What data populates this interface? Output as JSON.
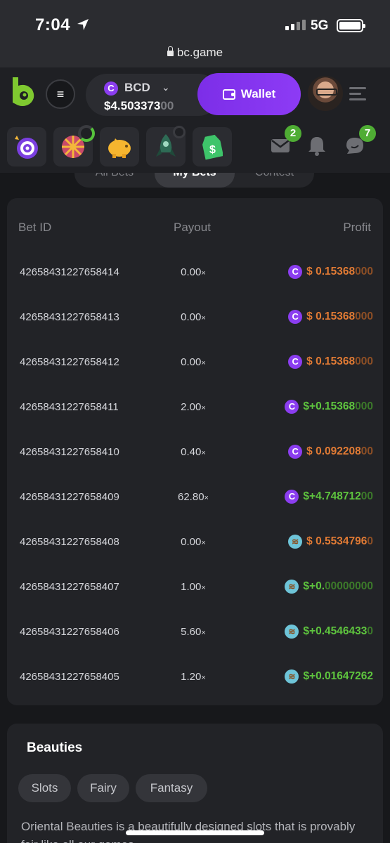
{
  "status": {
    "time": "7:04",
    "network": "5G"
  },
  "browser": {
    "url": "bc.game"
  },
  "header": {
    "currency": "BCD",
    "balance_main": "$4.503373",
    "balance_dim": "00",
    "wallet_label": "Wallet"
  },
  "promo": {
    "mail_badge": "2",
    "chat_badge": "7"
  },
  "tabs": [
    {
      "label": "All Bets"
    },
    {
      "label": "My Bets"
    },
    {
      "label": "Contest"
    }
  ],
  "table": {
    "headers": {
      "bet_id": "Bet ID",
      "payout": "Payout",
      "profit": "Profit"
    },
    "rows": [
      {
        "id": "42658431227658414",
        "payout": "0.00",
        "coin": "bcd",
        "sign": "neg",
        "profit": "$ 0.15368",
        "fade": "000"
      },
      {
        "id": "42658431227658413",
        "payout": "0.00",
        "coin": "bcd",
        "sign": "neg",
        "profit": "$ 0.15368",
        "fade": "000"
      },
      {
        "id": "42658431227658412",
        "payout": "0.00",
        "coin": "bcd",
        "sign": "neg",
        "profit": "$ 0.15368",
        "fade": "000"
      },
      {
        "id": "42658431227658411",
        "payout": "2.00",
        "coin": "bcd",
        "sign": "pos",
        "profit": "$+0.15368",
        "fade": "000"
      },
      {
        "id": "42658431227658410",
        "payout": "0.40",
        "coin": "bcd",
        "sign": "neg",
        "profit": "$ 0.092208",
        "fade": "00"
      },
      {
        "id": "42658431227658409",
        "payout": "62.80",
        "coin": "bcd",
        "sign": "pos",
        "profit": "$+4.748712",
        "fade": "00"
      },
      {
        "id": "42658431227658408",
        "payout": "0.00",
        "coin": "pan",
        "sign": "neg",
        "profit": "$ 0.5534796",
        "fade": "0"
      },
      {
        "id": "42658431227658407",
        "payout": "1.00",
        "coin": "pan",
        "sign": "pos",
        "profit": "$+0.",
        "fade": "00000000"
      },
      {
        "id": "42658431227658406",
        "payout": "5.60",
        "coin": "pan",
        "sign": "pos",
        "profit": "$+0.4546433",
        "fade": "0"
      },
      {
        "id": "42658431227658405",
        "payout": "1.20",
        "coin": "pan",
        "sign": "pos",
        "profit": "$+0.01647262",
        "fade": ""
      }
    ],
    "payout_suffix": "×"
  },
  "game": {
    "title": "Beauties",
    "tags": [
      "Slots",
      "Fairy",
      "Fantasy"
    ],
    "description": "Oriental Beauties is a beautifully designed slots that is provably fair like all our games."
  },
  "colors": {
    "accent": "#8d3bf5",
    "loss": "#e07a34",
    "win": "#5ec43e",
    "badge": "#4fad34"
  }
}
